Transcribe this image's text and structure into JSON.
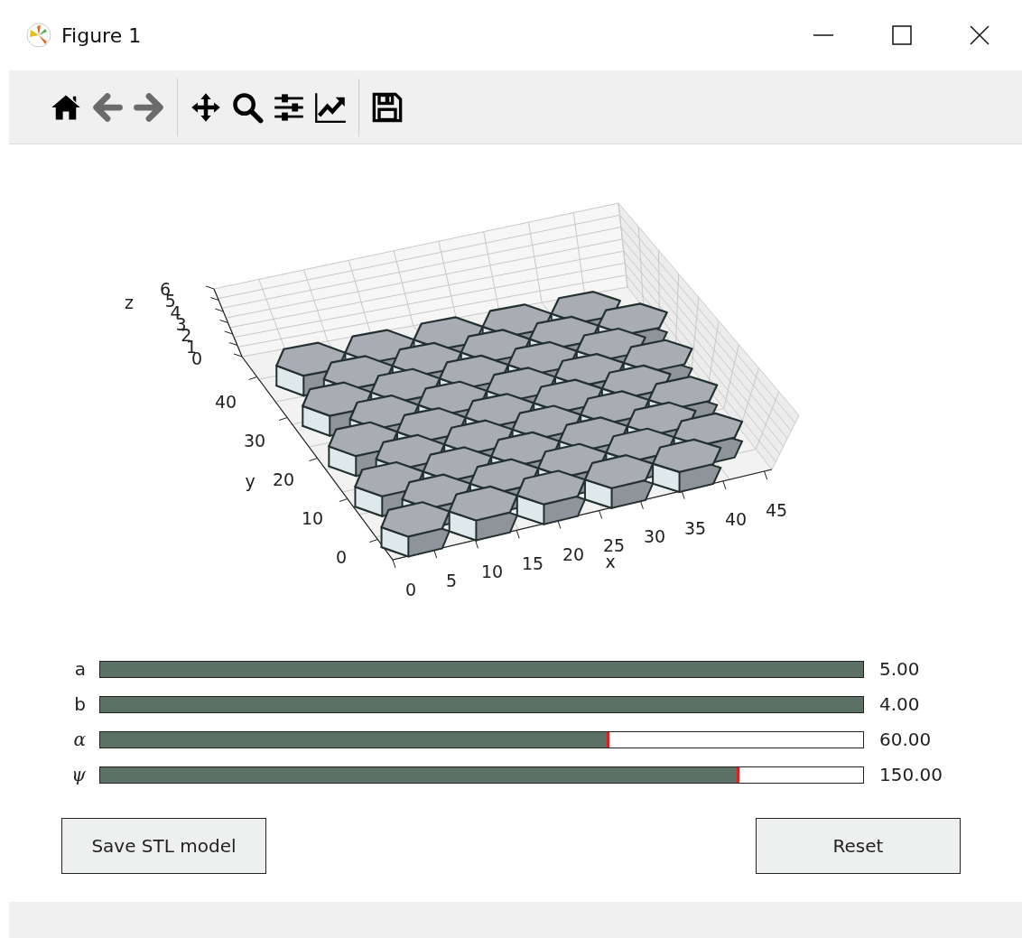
{
  "window": {
    "title": "Figure 1"
  },
  "toolbar": [
    {
      "kind": "home",
      "disabled": false
    },
    {
      "kind": "back",
      "disabled": true
    },
    {
      "kind": "forward",
      "disabled": true
    },
    {
      "kind": "separator"
    },
    {
      "kind": "pan",
      "disabled": false
    },
    {
      "kind": "zoom",
      "disabled": false
    },
    {
      "kind": "configure",
      "disabled": false
    },
    {
      "kind": "edit",
      "disabled": false
    },
    {
      "kind": "separator"
    },
    {
      "kind": "save",
      "disabled": false
    }
  ],
  "plot": {
    "x_label": "x",
    "y_label": "y",
    "z_label": "z",
    "x_ticks": [
      "0",
      "5",
      "10",
      "15",
      "20",
      "25",
      "30",
      "35",
      "40",
      "45"
    ],
    "y_ticks": [
      "0",
      "10",
      "20",
      "30",
      "40"
    ],
    "z_ticks": [
      "0",
      "1",
      "2",
      "3",
      "4",
      "5",
      "6"
    ]
  },
  "sliders": [
    {
      "label": "a",
      "math": false,
      "level": 1,
      "reading": "5.00"
    },
    {
      "label": "b",
      "math": false,
      "level": 1,
      "reading": "4.00"
    },
    {
      "label": "α",
      "math": true,
      "level": 0.667,
      "reading": "60.00"
    },
    {
      "label": "ψ",
      "math": true,
      "level": 0.838,
      "reading": "150.00"
    }
  ],
  "buttons": [
    {
      "label": "Save STL model"
    },
    {
      "label": "Reset"
    }
  ]
}
